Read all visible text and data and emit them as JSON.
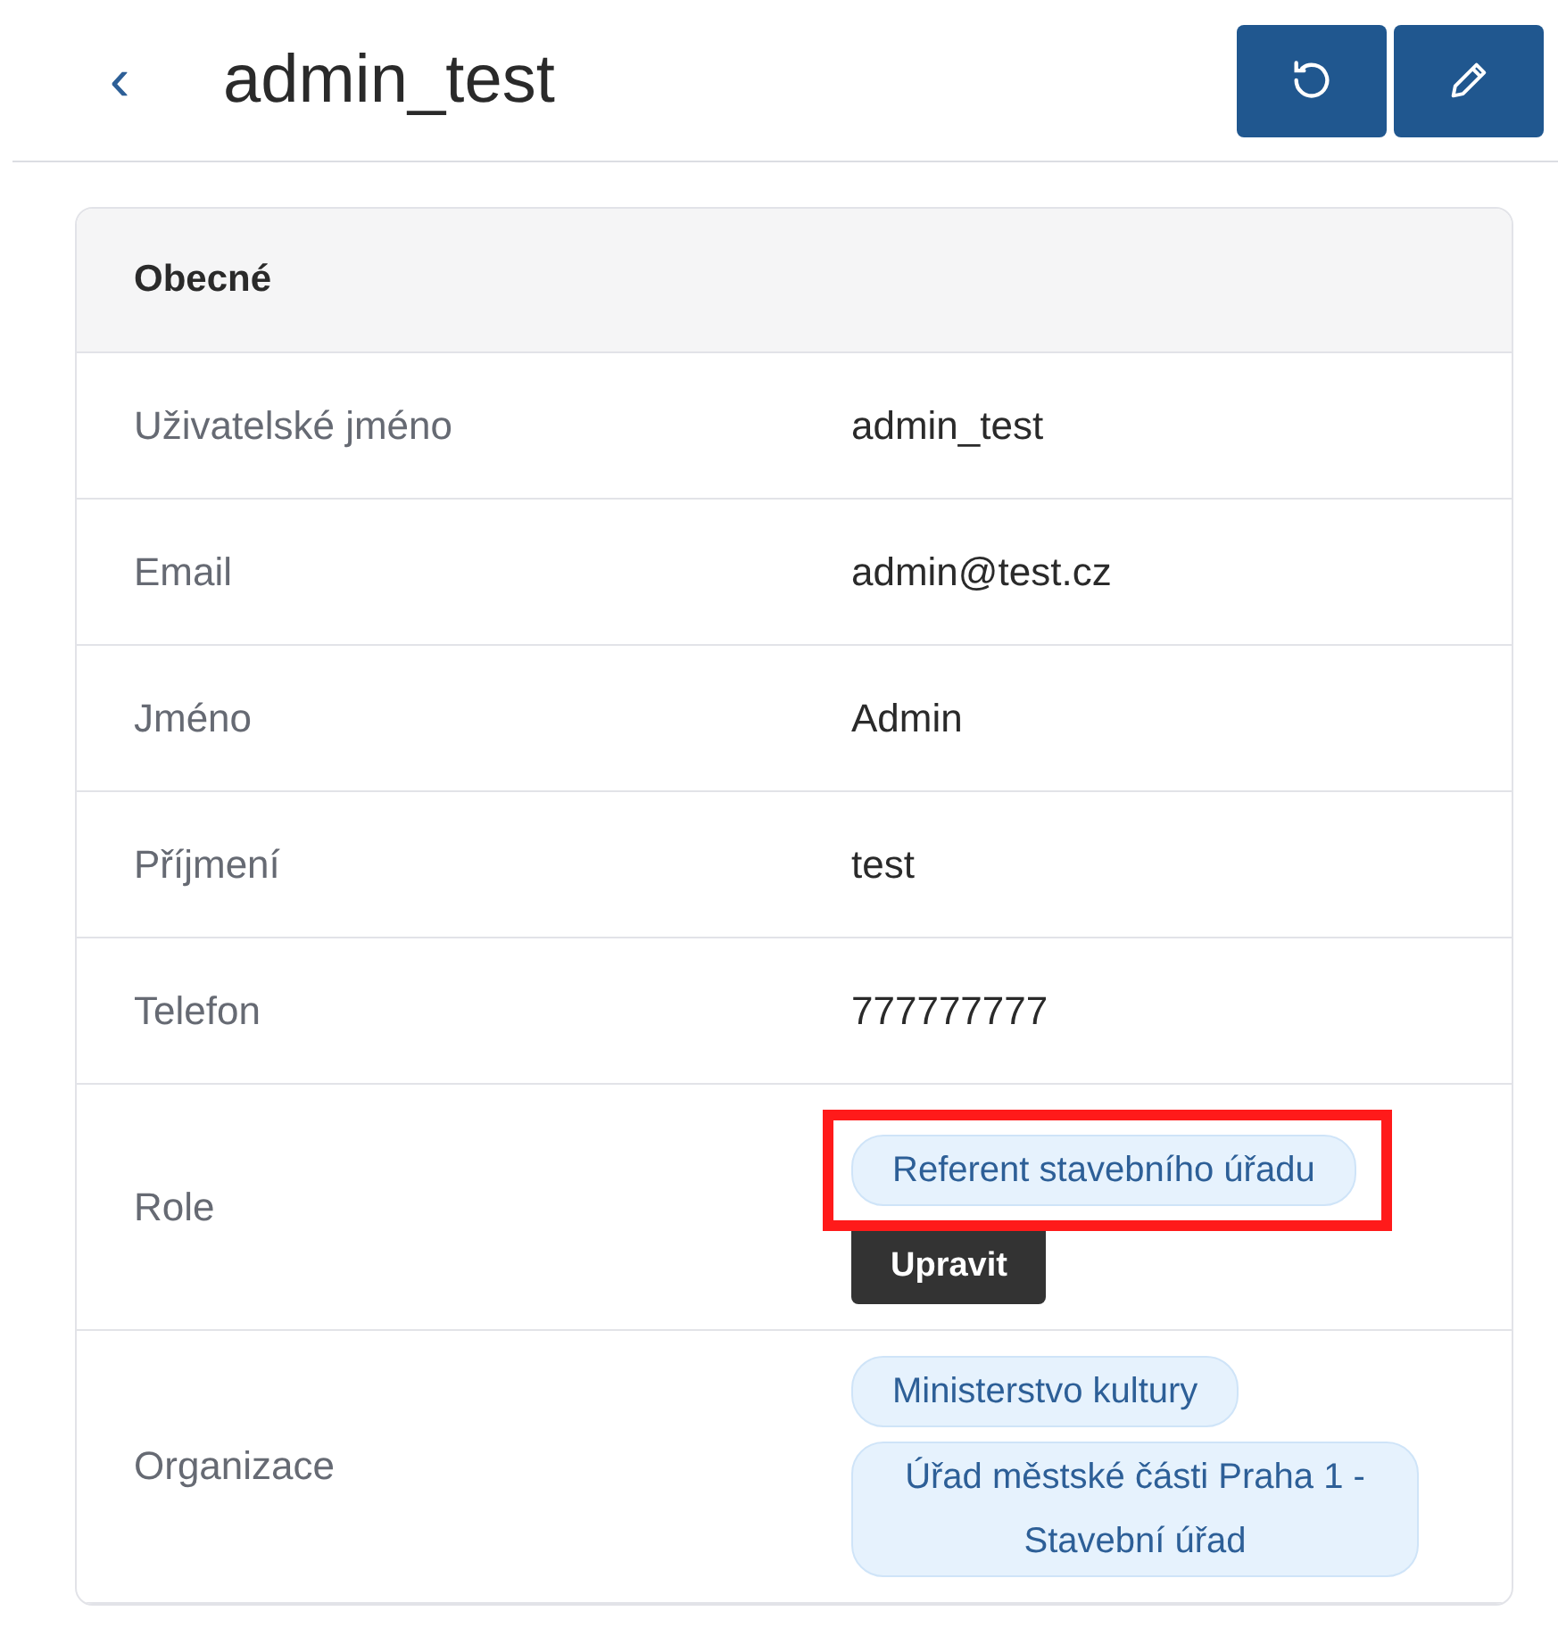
{
  "header": {
    "back_icon_char": "‹",
    "title": "admin_test"
  },
  "card": {
    "title": "Obecné",
    "rows": [
      {
        "kind": "text",
        "label": "Uživatelské jméno",
        "value": "admin_test"
      },
      {
        "kind": "text",
        "label": "Email",
        "value": "admin@test.cz"
      },
      {
        "kind": "text",
        "label": "Jméno",
        "value": "Admin"
      },
      {
        "kind": "text",
        "label": "Příjmení",
        "value": "test"
      },
      {
        "kind": "text",
        "label": "Telefon",
        "value": "777777777"
      },
      {
        "kind": "chips",
        "label": "Role",
        "chips": [
          {
            "text": "Referent stavebního úřadu",
            "highlighted": true
          }
        ],
        "tooltip": "Upravit"
      },
      {
        "kind": "chips",
        "label": "Organizace",
        "chips": [
          {
            "text": "Ministerstvo kultury",
            "highlighted": false
          },
          {
            "text": "Úřad městské části Praha 1 - Stavební úřad",
            "highlighted": false
          }
        ]
      }
    ]
  }
}
